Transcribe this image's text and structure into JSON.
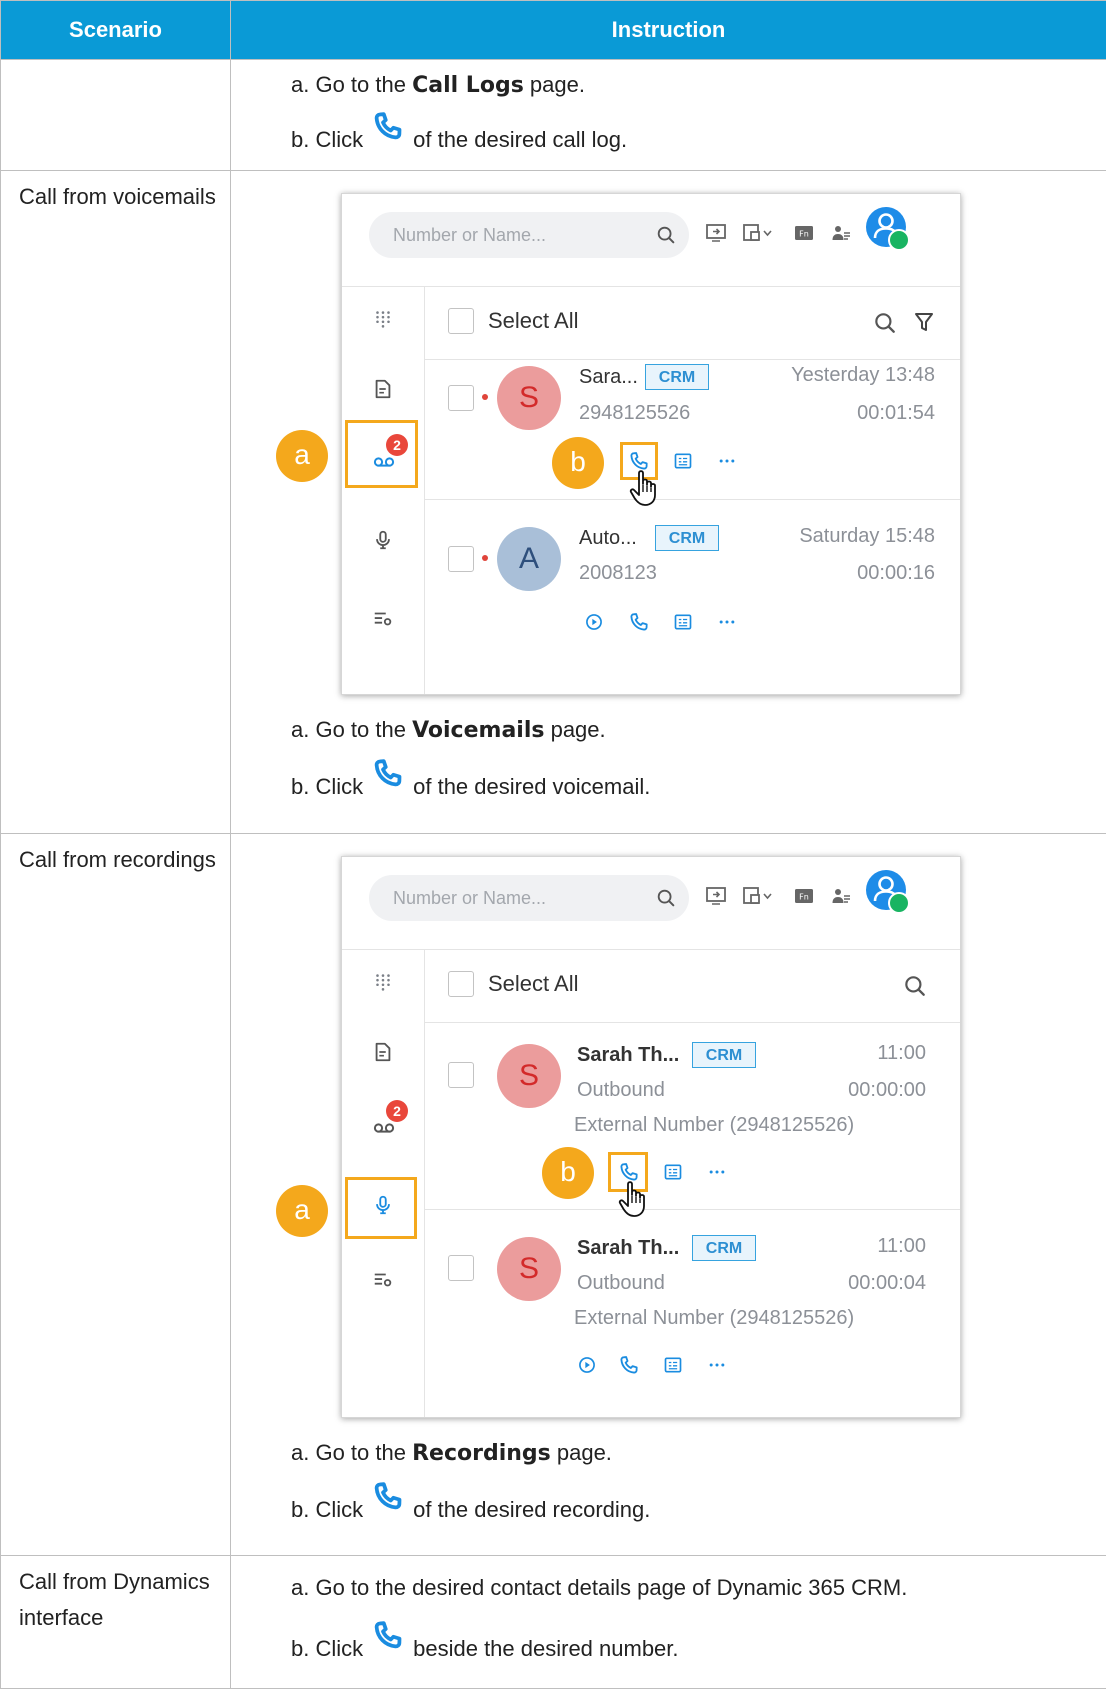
{
  "table": {
    "header": {
      "scenario": "Scenario",
      "instruction": "Instruction"
    },
    "row0": {
      "a_prefix": "a. Go to the ",
      "a_bold": "Call Logs",
      "a_suffix": " page.",
      "b_prefix": "b. Click",
      "b_suffix": "of the desired call log."
    },
    "row1": {
      "scenario": "Call from voicemails",
      "a_prefix": "a. Go to the ",
      "a_bold": "Voicemails",
      "a_suffix": " page.",
      "b_prefix": "b. Click",
      "b_suffix": "of the desired voicemail."
    },
    "row2": {
      "scenario": "Call from recordings",
      "a_prefix": "a. Go to the ",
      "a_bold": "Recordings",
      "a_suffix": " page.",
      "b_prefix": "b. Click",
      "b_suffix": "of the desired recording."
    },
    "row3": {
      "scenario": "Call from Dynamics interface",
      "a_text": "a. Go to the desired contact details page of Dynamic 365 CRM.",
      "b_prefix": "b. Click",
      "b_suffix": "beside the desired number."
    }
  },
  "shot1": {
    "search_placeholder": "Number or Name...",
    "select_all": "Select All",
    "badge": "2",
    "callout_a": "a",
    "callout_b": "b",
    "items": [
      {
        "initial": "S",
        "name": "Sara...",
        "crm": "CRM",
        "date": "Yesterday 13:48",
        "number": "2948125526",
        "duration": "00:01:54"
      },
      {
        "initial": "A",
        "name": "Auto...",
        "crm": "CRM",
        "date": "Saturday 15:48",
        "number": "2008123",
        "duration": "00:00:16"
      }
    ]
  },
  "shot2": {
    "search_placeholder": "Number or Name...",
    "select_all": "Select All",
    "badge": "2",
    "callout_a": "a",
    "callout_b": "b",
    "items": [
      {
        "initial": "S",
        "name": "Sarah Th...",
        "crm": "CRM",
        "time": "11:00",
        "direction": "Outbound",
        "duration": "00:00:00",
        "external": "External Number (2948125526)"
      },
      {
        "initial": "S",
        "name": "Sarah Th...",
        "crm": "CRM",
        "time": "11:00",
        "direction": "Outbound",
        "duration": "00:00:04",
        "external": "External Number (2948125526)"
      }
    ]
  },
  "colors": {
    "header_bg": "#0a9ad6",
    "accent_blue": "#1e8ce8",
    "callout": "#f4a81c",
    "badge": "#e9473b"
  },
  "icons": [
    "phone-icon",
    "search-icon",
    "filter-icon",
    "dialpad-icon",
    "contacts-icon",
    "voicemail-icon",
    "microphone-icon",
    "settings-list-icon",
    "play-icon",
    "note-icon",
    "more-icon",
    "hand-cursor-icon"
  ]
}
